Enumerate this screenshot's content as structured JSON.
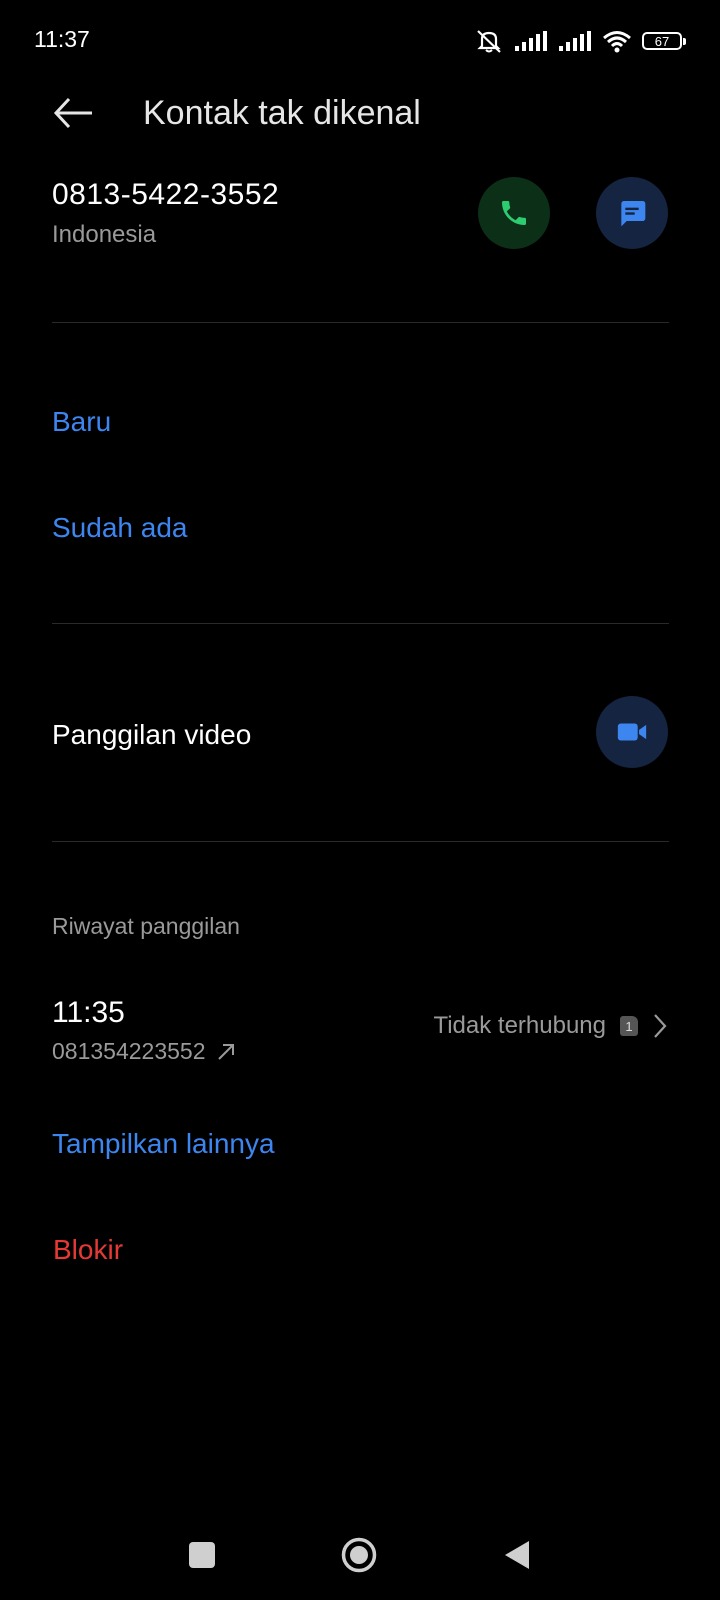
{
  "status_bar": {
    "time": "11:37",
    "battery": "67"
  },
  "header": {
    "title": "Kontak tak dikenal"
  },
  "contact": {
    "number": "0813-5422-3552",
    "region": "Indonesia"
  },
  "add_contact": {
    "new_label": "Baru",
    "existing_label": "Sudah ada"
  },
  "video_call": {
    "label": "Panggilan video"
  },
  "call_history": {
    "section_label": "Riwayat panggilan",
    "entries": [
      {
        "time": "11:35",
        "number": "081354223552",
        "status": "Tidak terhubung",
        "sim": "1"
      }
    ],
    "show_more_label": "Tampilkan lainnya"
  },
  "block": {
    "label": "Blokir"
  },
  "colors": {
    "accent_blue": "#3d86f0",
    "call_green": "#2ecc71",
    "danger_red": "#e53935"
  },
  "icons": {
    "back": "arrow-left-icon",
    "call": "phone-icon",
    "message": "message-icon",
    "video": "video-camera-icon",
    "outgoing": "outgoing-arrow-icon",
    "chevron": "chevron-right-icon"
  }
}
